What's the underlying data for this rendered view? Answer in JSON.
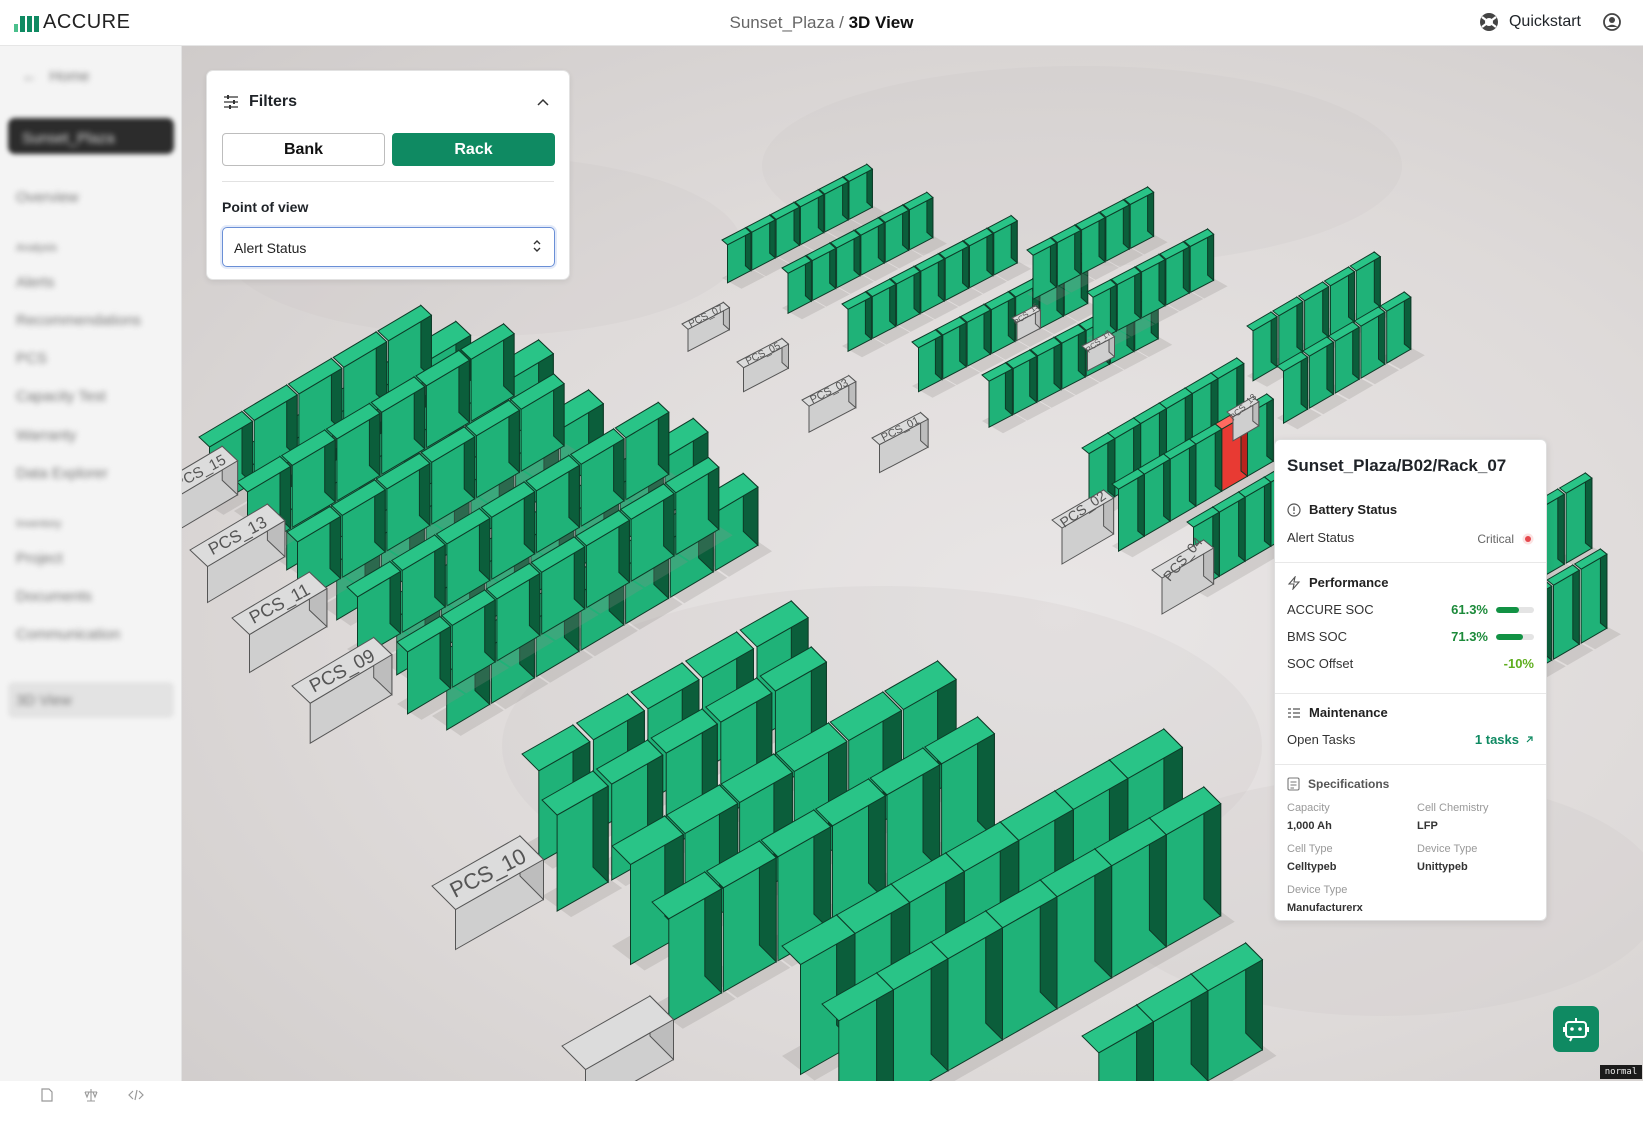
{
  "app": {
    "logo_text": "ACCURE"
  },
  "header": {
    "site": "Sunset_Plaza",
    "separator": " / ",
    "view": "3D View",
    "quickstart": "Quickstart"
  },
  "sidebar": {
    "back": "Home",
    "site": "Sunset_Plaza",
    "items": [
      "Overview",
      "Analysis",
      "Alerts",
      "Recommendations",
      "PCS",
      "Capacity Test",
      "Warranty",
      "Data Explorer",
      "Inventory",
      "Project",
      "Documents",
      "Communication",
      "3D View"
    ]
  },
  "filters": {
    "title": "Filters",
    "bank_label": "Bank",
    "rack_label": "Rack",
    "pov_label": "Point of view",
    "pov_value": "Alert Status"
  },
  "scene": {
    "pcs_labels": [
      "PCS_15",
      "PCS_13",
      "PCS_11",
      "PCS_09",
      "PCS_10",
      "PCS_07",
      "PCS_05",
      "PCS_03",
      "PCS_01",
      "PCS_15",
      "PCS_17",
      "PCS_13",
      "PCS_02",
      "PCS_04"
    ],
    "colors": {
      "rack_green": "#1fb278",
      "rack_dark": "#0b5e3b",
      "rack_critical": "#e83a33",
      "pcs_gray": "#dcdcdc"
    }
  },
  "info": {
    "title": "Sunset_Plaza/B02/Rack_07",
    "battery_status": {
      "heading": "Battery Status",
      "alert_label": "Alert Status",
      "alert_value": "Critical",
      "alert_color": "#e5484d"
    },
    "performance": {
      "heading": "Performance",
      "accure_soc_label": "ACCURE SOC",
      "accure_soc_value": "61.3%",
      "accure_soc": 0.613,
      "bms_soc_label": "BMS SOC",
      "bms_soc_value": "71.3%",
      "bms_soc": 0.713,
      "soc_offset_label": "SOC Offset",
      "soc_offset_value": "-10%"
    },
    "maintenance": {
      "heading": "Maintenance",
      "tasks_label": "Open Tasks",
      "tasks_value": "1 tasks"
    },
    "specifications": {
      "heading": "Specifications",
      "capacity_label": "Capacity",
      "capacity_value": "1,000 Ah",
      "chemistry_label": "Cell Chemistry",
      "chemistry_value": "LFP",
      "cell_type_label": "Cell Type",
      "cell_type_value": "Celltypeb",
      "device_type_label": "Device Type",
      "device_type_value": "Unittypeb",
      "manufacturer_label": "Device Type",
      "manufacturer_value": "Manufacturerx"
    }
  },
  "status": {
    "mode": "normal"
  }
}
